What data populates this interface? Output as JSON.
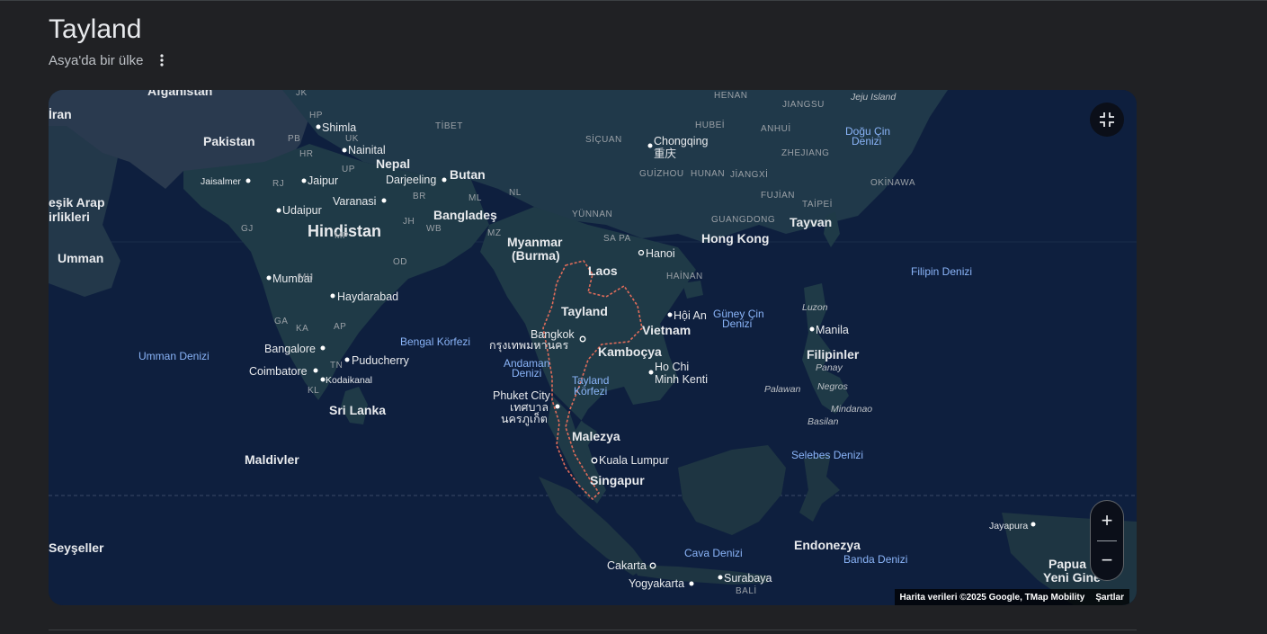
{
  "header": {
    "title": "Tayland",
    "subtitle": "Asya'da bir ülke",
    "more_icon": "more-vert-icon"
  },
  "map": {
    "colors": {
      "water": "#0e1f3e",
      "land": "#1f3a47",
      "land_alt": "#2a3d52",
      "border_highlight": "#e06c5a"
    },
    "labels": {
      "countries": {
        "afganistan": "Afganistan",
        "iran": "İran",
        "pakistan": "Pakistan",
        "nepal": "Nepal",
        "butan": "Butan",
        "bae": "eşik Arap\nirlikleri",
        "hindistan": "Hindistan",
        "banglades": "Bangladeş",
        "umman": "Umman",
        "myanmar": "Myanmar\n(Burma)",
        "laos": "Laos",
        "tayland": "Tayland",
        "vietnam": "Vietnam",
        "kambocya": "Kamboçya",
        "malezya": "Malezya",
        "singapur": "Singapur",
        "sri_lanka": "Sri Lanka",
        "maldivler": "Maldivler",
        "filipinler": "Filipinler",
        "tayvan": "Tayvan",
        "hong_kong": "Hong Kong",
        "endonezya": "Endonezya",
        "seyseller": "Seyşeller",
        "papua": "Papua\nYeni Gine"
      },
      "cities": {
        "shimla": "Shimla",
        "nainital": "Nainital",
        "jaisalmer": "Jaisalmer",
        "jaipur": "Jaipur",
        "darjeeling": "Darjeeling",
        "varanasi": "Varanasi",
        "udaipur": "Udaipur",
        "mumbai": "Mumbai",
        "haydarabad": "Haydarabad",
        "bangalore": "Bangalore",
        "puducherry": "Puducherry",
        "coimbatore": "Coimbatore",
        "kodaikanal": "Kodaikanal",
        "chongqing": "Chongqing",
        "chongqing_native": "重庆",
        "hanoi": "Hanoi",
        "hoi_an": "Hội An",
        "bangkok": "Bangkok",
        "bangkok_native": "กรุงเทพมหานคร",
        "ho_chi_minh": "Ho Chi\nMinh Kenti",
        "phuket": "Phuket City",
        "phuket_native": "เทศบาล\nนครภูเก็ต",
        "kuala_lumpur": "Kuala Lumpur",
        "manila": "Manila",
        "cakarta": "Cakarta",
        "yogyakarta": "Yogyakarta",
        "surabaya": "Surabaya",
        "jayapura": "Jayapura"
      },
      "regions": {
        "jk": "JK",
        "hp": "HP",
        "pb": "PB",
        "hr": "HR",
        "uk": "UK",
        "up": "UP",
        "rj": "RJ",
        "br": "BR",
        "ml": "ML",
        "nl": "NL",
        "gj": "GJ",
        "mp": "MP",
        "jh": "JH",
        "wb": "WB",
        "mz": "MZ",
        "od": "OD",
        "mh": "MH",
        "ga": "GA",
        "ka": "KA",
        "ap": "AP",
        "tn": "TN",
        "kl": "KL",
        "tibet": "TİBET",
        "sicuan": "SİÇUAN",
        "hubei": "HUBEİ",
        "henan": "HENAN",
        "anhui": "ANHUİ",
        "jiangsu": "JIANGSU",
        "zhejiang": "ZHEJIANG",
        "guizhou": "GUİZHOU",
        "hunan": "HUNAN",
        "jiangxi": "JİANGXİ",
        "fujian": "FUJİAN",
        "yunnan": "YÜNNAN",
        "guangdong": "GUANGDONG",
        "sa_pa": "SA PA",
        "hainan": "HAİNAN",
        "taipei": "TAİPEİ",
        "okinawa": "OKİNAWA",
        "bali": "BALİ"
      },
      "seas": {
        "umman_denizi": "Umman Denizi",
        "bengal": "Bengal Körfezi",
        "andaman": "Andaman\nDenizi",
        "tayland_korfezi": "Tayland\nKörfezi",
        "guney_cin": "Güney Çin\nDenizi",
        "dogu_cin": "Doğu Çin\nDenizi",
        "filipin": "Filipin Denizi",
        "selebes": "Selebes Denizi",
        "cava": "Cava Denizi",
        "banda": "Banda Denizi",
        "jeju": "Jeju Island"
      },
      "islands": {
        "luzon": "Luzon",
        "panay": "Panay",
        "negros": "Negros",
        "palawan": "Palawan",
        "mindanao": "Mindanao",
        "basilan": "Basilan"
      }
    }
  },
  "controls": {
    "fullscreen_icon": "exit-fullscreen-icon",
    "zoom_in": "+",
    "zoom_out": "−"
  },
  "attribution": {
    "data": "Harita verileri ©2025 Google, TMap Mobility",
    "terms": "Şartlar"
  }
}
